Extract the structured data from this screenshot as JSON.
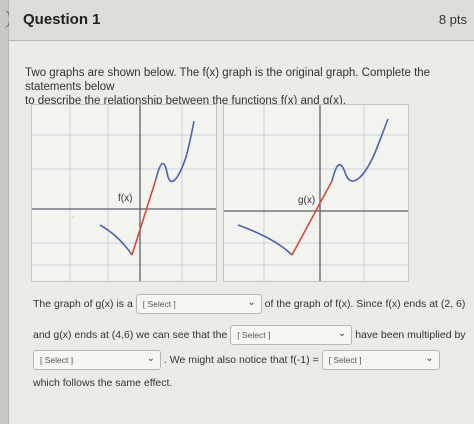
{
  "question": {
    "title": "Question 1",
    "points": "8 pts"
  },
  "prompt": {
    "line1": "Two graphs are shown below. The f(x) graph is the original graph. Complete the statements below",
    "line2": "to describe the relationship between the functions f(x) and g(x)."
  },
  "graphs": {
    "left_label": "f(x)",
    "right_label": "g(x)"
  },
  "statement": {
    "part1": "The graph of g(x) is a",
    "part2": "of the graph of f(x).  Since f(x) ends at (2, 6)",
    "part3": "and g(x) ends at (4,6) we can see that the",
    "part4": "have been multiplied by",
    "part5": ". We might also notice that f(-1) =",
    "part6": "which follows the same effect."
  },
  "dropdowns": {
    "dd1": "[ Select ]",
    "dd2": "[ Select ]",
    "dd3": "[ Select ]",
    "dd4": "[ Select ]"
  },
  "colors": {
    "curve_blue": "#4c63a8",
    "segment_red": "#d24a3a",
    "axis": "#5a5f68",
    "grid": "#c9d0d8"
  }
}
